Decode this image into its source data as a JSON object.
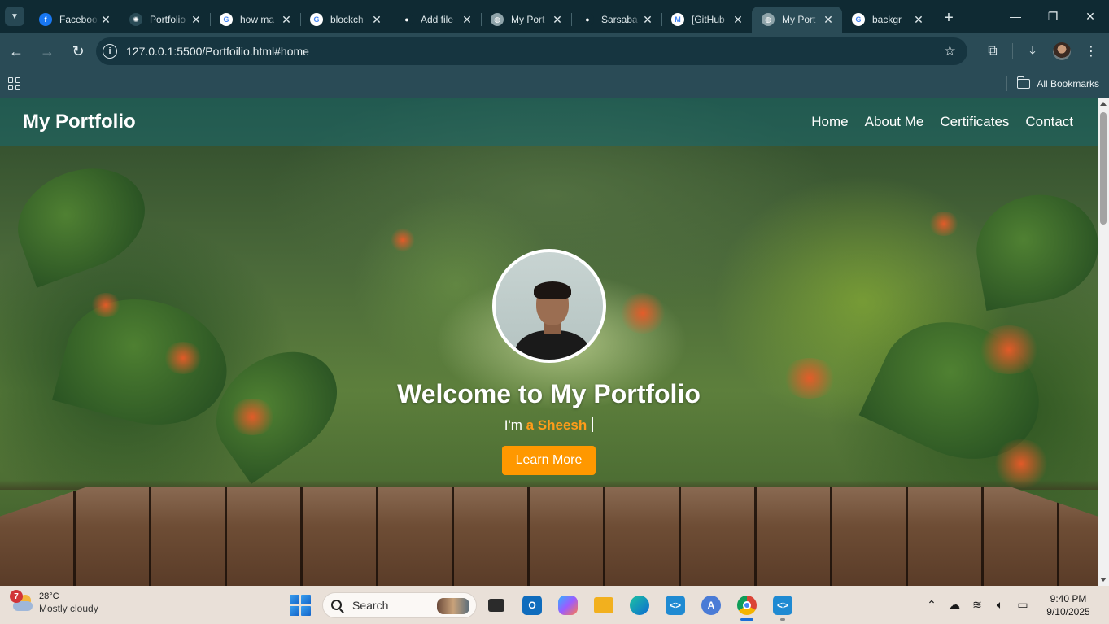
{
  "browser": {
    "tabs": [
      {
        "title": "Facebook",
        "icon": "facebook-icon",
        "color": "#1877f2",
        "glyph": "f",
        "active": false
      },
      {
        "title": "Portfolio",
        "icon": "openai-icon",
        "color": "#2a4b56",
        "glyph": "✺",
        "active": false
      },
      {
        "title": "how ma",
        "icon": "google-icon",
        "color": "#ffffff",
        "glyph": "G",
        "active": false
      },
      {
        "title": "blockch",
        "icon": "google-icon",
        "color": "#ffffff",
        "glyph": "G",
        "active": false
      },
      {
        "title": "Add file",
        "icon": "github-icon",
        "color": "#0f2a33",
        "glyph": "●",
        "active": false
      },
      {
        "title": "My Port",
        "icon": "globe-icon",
        "color": "#8fa4aa",
        "glyph": "◍",
        "active": false
      },
      {
        "title": "Sarsaba",
        "icon": "github-icon",
        "color": "#0f2a33",
        "glyph": "●",
        "active": false
      },
      {
        "title": "[GitHub",
        "icon": "gmail-icon",
        "color": "#ffffff",
        "glyph": "M",
        "active": false
      },
      {
        "title": "My Port",
        "icon": "globe-icon",
        "color": "#8fa4aa",
        "glyph": "◍",
        "active": true
      },
      {
        "title": "backgr",
        "icon": "google-icon",
        "color": "#ffffff",
        "glyph": "G",
        "active": false
      }
    ],
    "url": "127.0.0.1:5500/Portfoilio.html#home",
    "bookmarks_label": "All Bookmarks"
  },
  "site": {
    "logo": "My Portfolio",
    "nav": [
      "Home",
      "About Me",
      "Certificates",
      "Contact"
    ],
    "hero": {
      "title": "Welcome to My Portfolio",
      "prefix": "I'm",
      "name": "a Sheesh",
      "button": "Learn More"
    },
    "accent_color": "#ff9800",
    "header_color": "#186870"
  },
  "taskbar": {
    "weather": {
      "badge": "7",
      "temp": "28°C",
      "desc": "Mostly cloudy"
    },
    "search_label": "Search",
    "time": "9:40 PM",
    "date": "9/10/2025"
  }
}
